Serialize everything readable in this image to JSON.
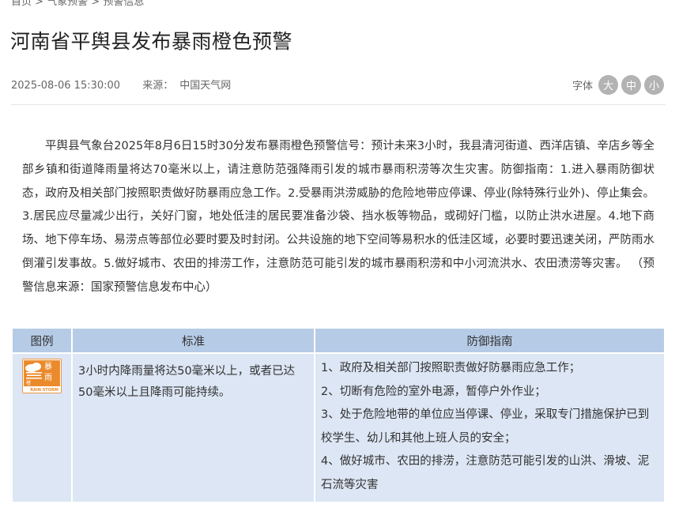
{
  "breadcrumb": "首页 > 气象预警 > 预警信息",
  "article": {
    "title": "河南省平舆县发布暴雨橙色预警",
    "datetime": "2025-08-06 15:30:00",
    "source_label": "来源：",
    "source": "中国天气网",
    "body": "平舆县气象台2025年8月6日15时30分发布暴雨橙色预警信号：预计未来3小时，我县清河街道、西洋店镇、辛店乡等全部乡镇和街道降雨量将达70毫米以上，请注意防范强降雨引发的城市暴雨积涝等次生灾害。防御指南：1.进入暴雨防御状态，政府及相关部门按照职责做好防暴雨应急工作。2.受暴雨洪涝威胁的危险地带应停课、停业(除特殊行业外)、停止集会。3.居民应尽量减少出行，关好门窗，地处低洼的居民要准备沙袋、挡水板等物品，或砌好门槛，以防止洪水进屋。4.地下商场、地下停车场、易涝点等部位必要时要及时封闭。公共设施的地下空间等易积水的低洼区域，必要时要迅速关闭，严防雨水倒灌引发事故。5.做好城市、农田的排涝工作，注意防范可能引发的城市暴雨积涝和中小河流洪水、农田渍涝等灾害。 （预警信息来源：国家预警信息发布中心）"
  },
  "font_size": {
    "label": "字体",
    "large": "大",
    "medium": "中",
    "small": "小"
  },
  "table": {
    "headers": [
      "图例",
      "标准",
      "防御指南"
    ],
    "standard": "3小时内降雨量将达50毫米以上，或者已达50毫米以上且降雨可能持续。",
    "guide": [
      "1、政府及相关部门按照职责做好防暴雨应急工作；",
      "2、切断有危险的室外电源，暂停户外作业；",
      "3、处于危险地带的单位应当停课、停业，采取专门措施保护已到校学生、幼儿和其他上班人员的安全；",
      "4、做好城市、农田的排涝，注意防范可能引发的山洪、滑坡、泥石流等灾害"
    ],
    "icon": {
      "name": "rainstorm-orange-warning-icon",
      "text_zh_top": "暴",
      "text_zh_bottom": "雨",
      "text_zh_color": "橙",
      "text_en": "RAIN STORM",
      "color": "#eb8a2b"
    }
  },
  "colors": {
    "header_bg": "#b6cbe6",
    "cell_bg": "#dce6f4",
    "font_btn_bg": "#b3b3b3"
  }
}
